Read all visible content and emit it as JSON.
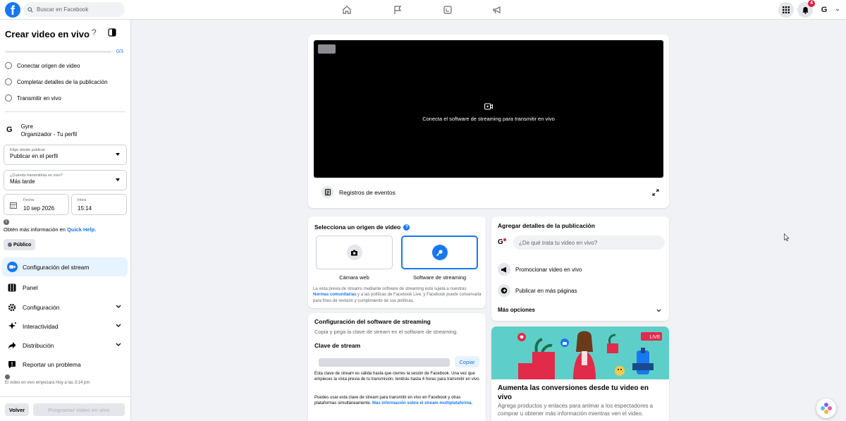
{
  "topbar": {
    "logo_letter": "f",
    "search_placeholder": "Buscar en Facebook",
    "notifications_count": "4",
    "profile_letter": "G"
  },
  "sidebar": {
    "title": "Crear video en vivo",
    "help_glyph": "?",
    "progress_text": "0/3",
    "progress_fraction": 0,
    "steps": [
      "Conectar origen de video",
      "Completar detalles de la publicación",
      "Transmitir en vivo"
    ],
    "owner": {
      "letter": "G",
      "name": "Gyre",
      "role": "Organizador - Tu perfil"
    },
    "publish_where": {
      "label": "Elige dónde publicar",
      "value": "Publicar en el perfil"
    },
    "when": {
      "label": "¿Cuándo transmitirás en vivo?",
      "value": "Más tarde"
    },
    "date": {
      "label": "Fecha",
      "value": "10 sep 2026"
    },
    "time": {
      "label": "Hora",
      "value": "15:14"
    },
    "info_prefix": "Obtén más información en ",
    "info_link": "Quick Help.",
    "privacy_button": "Público",
    "menu": [
      {
        "label": "Configuración del stream",
        "active": true
      },
      {
        "label": "Panel"
      },
      {
        "label": "Configuración"
      },
      {
        "label": "Interactividad"
      },
      {
        "label": "Distribución"
      },
      {
        "label": "Reportar un problema"
      }
    ],
    "footnote": "El video en vivo empezará Hoy a las 3:14 pm",
    "back_button": "Volver",
    "schedule_button": "Programar video en vivo"
  },
  "preview": {
    "message": "Conecta el software de streaming para transmitir en vivo",
    "event_log": "Registros de eventos"
  },
  "source": {
    "title": "Selecciona un origen de video",
    "options": [
      "Cámara web",
      "Software de streaming"
    ],
    "selected": "Software de streaming",
    "disclaimer_1": "La vista previa de streams mediante software de streaming está sujeta a nuestras",
    "disclaimer_link": "Normas comunitarias",
    "disclaimer_2": " y a las políticas de Facebook Live, y Facebook puede conservarla para fines de revisión y cumplimiento de sus políticas."
  },
  "software": {
    "title": "Configuración del software de streaming",
    "subtitle": "Copia y pega la clave de stream en el software de streaming.",
    "key_label": "Clave de stream",
    "copy_button": "Copiar",
    "key_note": "Esta clave de stream es válida hasta que cierres la sesión de Facebook. Una vez que empieces la vista previa de tu transmisión, tendrás hasta 4 horas para transmitir en vivo.",
    "multi_note": "Puedes usar esta clave de stream para transmitir en vivo en Facebook y otras plataformas simultáneamente. ",
    "multi_link": "Más información sobre el stream multiplataforma."
  },
  "details": {
    "title": "Agregar detalles de la publicación",
    "input_placeholder": "¿De qué trata tu video en vivo?",
    "promote": "Promocionar video en vivo",
    "more_pages": "Publicar en más páginas",
    "more_options": "Más opciones"
  },
  "promo": {
    "live_badge": "LIVE",
    "title": "Aumenta las conversiones desde tu video en vivo",
    "subtitle": "Agrega productos y enlaces para animar a los espectadores a comprar u obtener más información mientras ven el video."
  },
  "colors": {
    "accent": "#1877f2",
    "badge": "#e41e3f",
    "promo_bg": "#5ecfc8"
  }
}
